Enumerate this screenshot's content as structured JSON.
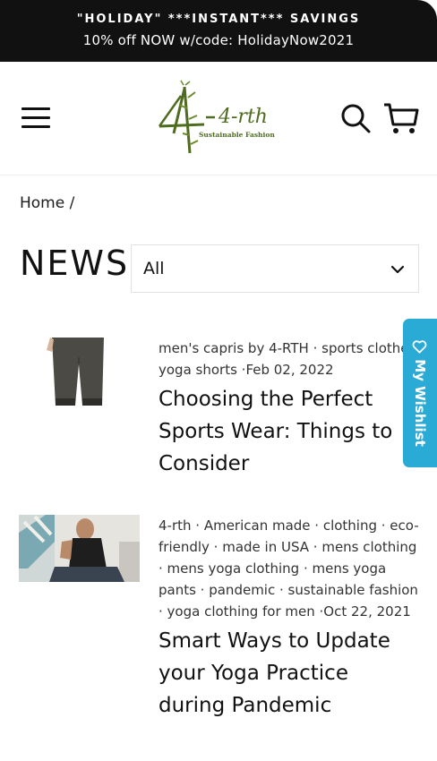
{
  "announcement": {
    "line1": "\"HOLIDAY\" ***INSTANT*** SAVINGS",
    "line2": "10% off NOW w/code: HolidayNow2021"
  },
  "header": {
    "logo_text": "4-rth",
    "logo_tagline": "Sustainable Fashion"
  },
  "breadcrumb": {
    "home": "Home",
    "separator": "/"
  },
  "page": {
    "title": "NEWS",
    "filter_value": "All"
  },
  "articles": [
    {
      "tags": [
        "men's capris by 4-RTH",
        "sports clothes",
        "yoga shorts"
      ],
      "tags_text": "men's capris by 4-RTH · sports clothes · yoga shorts ·",
      "date": "Feb 02, 2022",
      "title": "Choosing the Perfect Sports Wear: Things to Consider"
    },
    {
      "tags": [
        "4-rth",
        "American made",
        "clothing",
        "eco-friendly",
        "made in USA",
        "mens clothing",
        "mens yoga clothing",
        "mens yoga pants",
        "pandemic",
        "sustainable fashion",
        "yoga clothing for men"
      ],
      "tags_text": "4-rth · American made · clothing · eco-friendly · made in USA · mens clothing · mens yoga clothing · mens yoga pants · pandemic · sustainable fashion · yoga clothing for men ·",
      "date": "Oct 22, 2021",
      "title": "Smart Ways to Update your Yoga Practice during Pandemic"
    }
  ],
  "wishlist": {
    "label": "My Wishlist"
  },
  "colors": {
    "announcement_bg": "#111111",
    "wishlist_bg": "#29abd6",
    "logo_green": "#4f6b1f"
  }
}
